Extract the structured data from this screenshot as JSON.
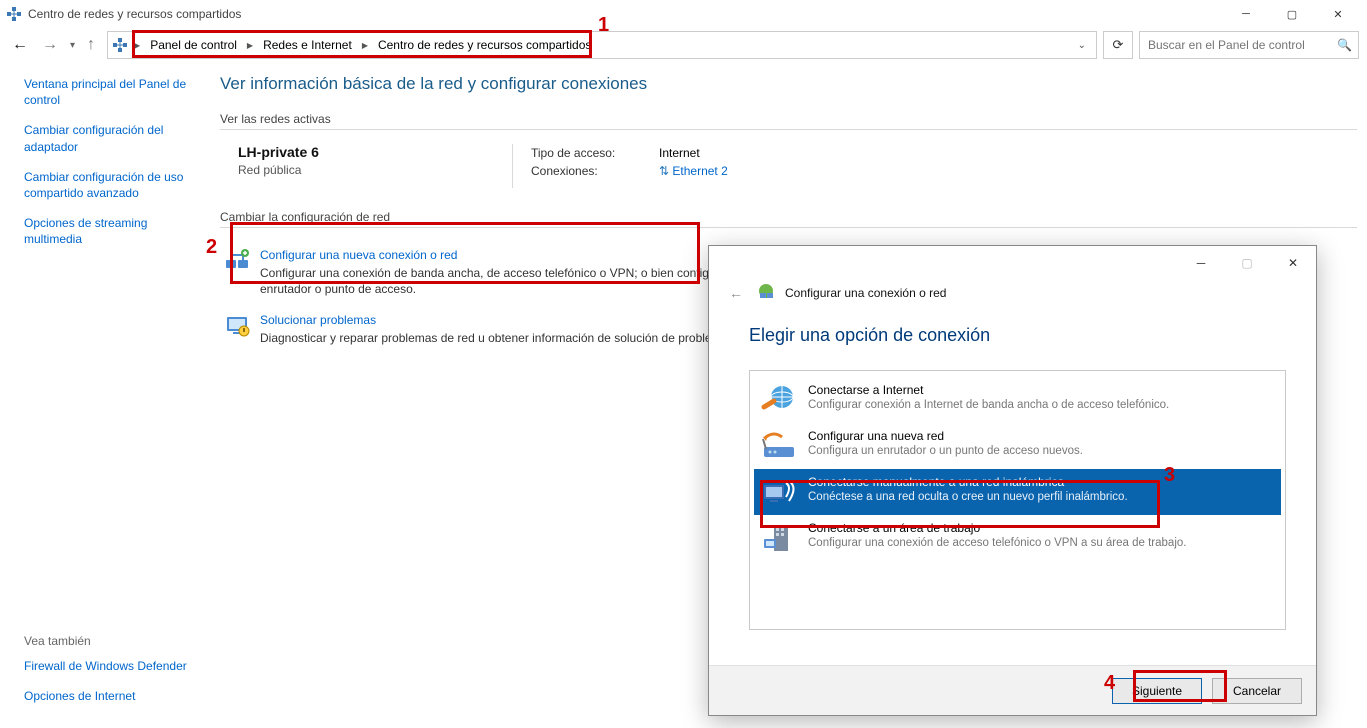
{
  "titlebar": {
    "title": "Centro de redes y recursos compartidos"
  },
  "breadcrumb": {
    "items": [
      "Panel de control",
      "Redes e Internet",
      "Centro de redes y recursos compartidos"
    ]
  },
  "search": {
    "placeholder": "Buscar en el Panel de control"
  },
  "sidebar": {
    "items": [
      "Ventana principal del Panel de control",
      "Cambiar configuración del adaptador",
      "Cambiar configuración de uso compartido avanzado",
      "Opciones de streaming multimedia"
    ],
    "see_also_header": "Vea también",
    "see_also_items": [
      "Firewall de Windows Defender",
      "Opciones de Internet"
    ]
  },
  "main": {
    "page_title": "Ver información básica de la red y configurar conexiones",
    "active_networks_header": "Ver las redes activas",
    "network": {
      "name": "LH-private 6",
      "type": "Red pública",
      "access_label": "Tipo de acceso:",
      "access_value": "Internet",
      "conn_label": "Conexiones:",
      "conn_value": "Ethernet 2"
    },
    "change_settings_header": "Cambiar la configuración de red",
    "actions": [
      {
        "title": "Configurar una nueva conexión o red",
        "desc": "Configurar una conexión de banda ancha, de acceso telefónico o VPN; o bien configurar un enrutador o punto de acceso."
      },
      {
        "title": "Solucionar problemas",
        "desc": "Diagnosticar y reparar problemas de red u obtener información de solución de problemas."
      }
    ]
  },
  "dialog": {
    "header_title": "Configurar una conexión o red",
    "heading": "Elegir una opción de conexión",
    "options": [
      {
        "title": "Conectarse a Internet",
        "desc": "Configurar conexión a Internet de banda ancha o de acceso telefónico.",
        "selected": false
      },
      {
        "title": "Configurar una nueva red",
        "desc": "Configura un enrutador o un punto de acceso nuevos.",
        "selected": false
      },
      {
        "title": "Conectarse manualmente a una red inalámbrica",
        "desc": "Conéctese a una red oculta o cree un nuevo perfil inalámbrico.",
        "selected": true
      },
      {
        "title": "Conectarse a un área de trabajo",
        "desc": "Configurar una conexión de acceso telefónico o VPN a su área de trabajo.",
        "selected": false
      }
    ],
    "next": "Siguiente",
    "cancel": "Cancelar"
  },
  "annotations": {
    "1": "1",
    "2": "2",
    "3": "3",
    "4": "4"
  }
}
